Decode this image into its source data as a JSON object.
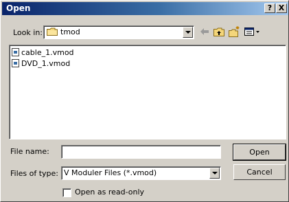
{
  "window": {
    "title": "Open"
  },
  "title_buttons": {
    "help": "?",
    "close": "X"
  },
  "look_in": {
    "label": "Look in:",
    "value": "tmod",
    "icon": "folder-icon"
  },
  "toolbar": {
    "icons": [
      "back-arrow-icon",
      "up-folder-icon",
      "new-folder-icon",
      "view-menu-icon"
    ]
  },
  "files": [
    {
      "name": "cable_1.vmod",
      "icon": "file-icon"
    },
    {
      "name": "DVD_1.vmod",
      "icon": "file-icon"
    }
  ],
  "file_name": {
    "label": "File name:",
    "value": ""
  },
  "files_of_type": {
    "label": "Files of type:",
    "value": "V Moduler Files (*.vmod)"
  },
  "buttons": {
    "open": "Open",
    "cancel": "Cancel"
  },
  "read_only": {
    "label": "Open as read-only",
    "checked": false
  },
  "colors": {
    "titlebar_start": "#0a246a",
    "titlebar_end": "#a6caf0",
    "face": "#d4d0c8"
  }
}
